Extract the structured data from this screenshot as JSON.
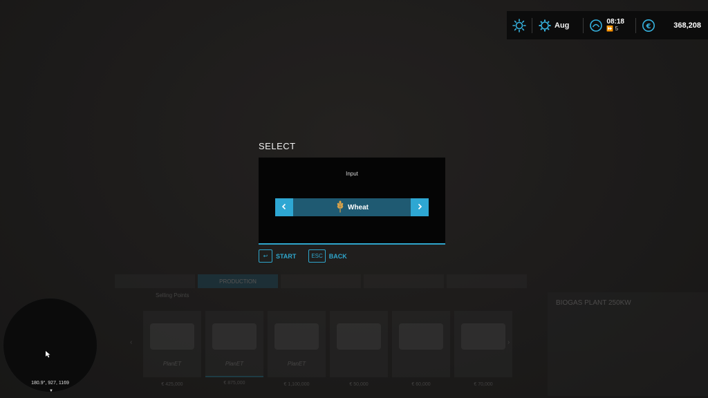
{
  "hud": {
    "weather_icon": "sun-icon",
    "season_icon": "sun-gear-icon",
    "month": "Aug",
    "clock_icon": "speed-gauge-icon",
    "time": "08:18",
    "time_scale": "5",
    "currency_icon": "euro-icon",
    "money": "368,208"
  },
  "dialog": {
    "title": "SELECT",
    "label": "Input",
    "selected_value": "Wheat",
    "selected_icon": "wheat-icon",
    "prev_icon": "chevron-left-icon",
    "next_icon": "chevron-right-icon",
    "actions": [
      {
        "key": "↩",
        "label": "START"
      },
      {
        "key": "ESC",
        "label": "BACK"
      }
    ]
  },
  "background_menu": {
    "tabs": [
      "",
      "PRODUCTION",
      "",
      "",
      ""
    ],
    "subtabs": [
      "",
      "Selling Points",
      "",
      "",
      ""
    ],
    "cards": [
      {
        "brand": "PlanET",
        "price": "€ 425,000"
      },
      {
        "brand": "PlanET",
        "price": "€ 875,000"
      },
      {
        "brand": "PlanET",
        "price": "€ 1,100,000"
      },
      {
        "brand": "",
        "price": "€ 50,000"
      },
      {
        "brand": "",
        "price": "€ 60,000"
      },
      {
        "brand": "",
        "price": "€ 70,000"
      }
    ],
    "side_title": "BIOGAS PLANT 250KW"
  },
  "minimap": {
    "coords": "180.9°, 927, 1169",
    "north_marker": "▼"
  },
  "colors": {
    "accent": "#2fa6cc",
    "selector_bg": "#1f5a72",
    "hud_bg": "#0c0c0c"
  }
}
